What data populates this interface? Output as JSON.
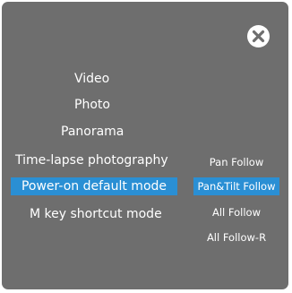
{
  "close": {
    "icon": "close-icon"
  },
  "menu": {
    "items": [
      {
        "label": "Video"
      },
      {
        "label": "Photo"
      },
      {
        "label": "Panorama"
      },
      {
        "label": "Time-lapse photography"
      },
      {
        "label": "Power-on default mode",
        "selected": true
      },
      {
        "label": "M key shortcut mode"
      }
    ]
  },
  "options": {
    "items": [
      {
        "label": "Pan Follow"
      },
      {
        "label": "Pan&Tilt Follow",
        "selected": true
      },
      {
        "label": "All Follow"
      },
      {
        "label": "All Follow-R"
      }
    ]
  },
  "colors": {
    "panel": "#6e6e6e",
    "accent": "#2a8fd4",
    "text": "#ffffff"
  }
}
